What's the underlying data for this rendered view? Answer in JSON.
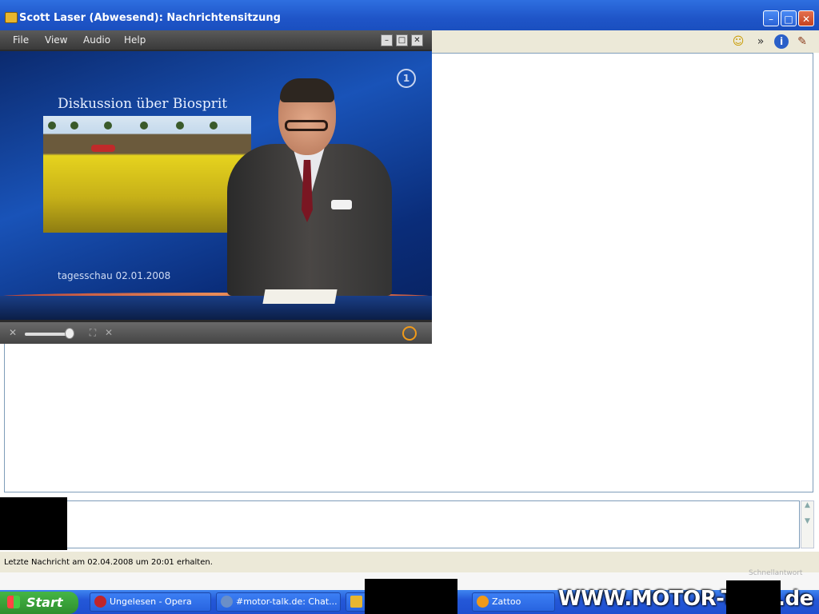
{
  "window": {
    "title": "Scott Laser (Abwesend): Nachrichtensitzung",
    "buttons": {
      "minimize": "–",
      "maximize": "□",
      "close": "✕"
    }
  },
  "toolbar": {
    "icons": [
      "smiley-icon",
      "chevron-down-icon",
      "info-icon",
      "book-icon"
    ],
    "smiley": "☺",
    "chevron": "»",
    "info": "i",
    "book": "✎"
  },
  "player": {
    "menu": [
      "File",
      "View",
      "Audio",
      "Help"
    ],
    "buttons": {
      "minimize": "–",
      "maximize": "□",
      "close": "✕"
    },
    "video": {
      "caption": "Diskussion über Biosprit",
      "ticker": "tagesschau  02.01.2008",
      "channel_logo": "1"
    },
    "volume_level": 0.9
  },
  "status": {
    "text": "Letzte Nachricht am 02.04.2008 um 20:01 erhalten.",
    "hint": "Schnellantwort"
  },
  "taskbar": {
    "start": "Start",
    "tasks": [
      {
        "label": "Ungelesen - Opera",
        "color": "#c0252b"
      },
      {
        "label": "#motor-talk.de: Chat...",
        "color": "#6a8fc8"
      },
      {
        "label": "",
        "color": "#e8b62f"
      },
      {
        "label": "Zattoo",
        "color": "#f09a1a"
      }
    ]
  },
  "watermark": "WWW.MOTOR-TALK.de"
}
